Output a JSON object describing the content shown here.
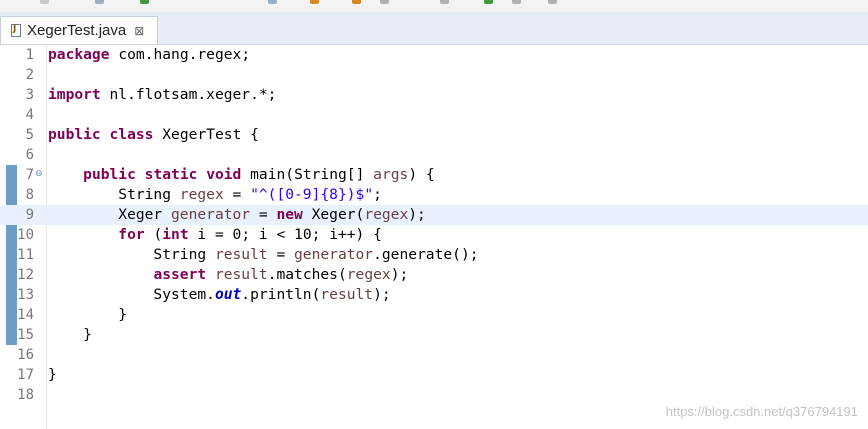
{
  "editor_tab": {
    "title": "XegerTest.java",
    "close_glyph": "⊠",
    "file_icon": "java-file-icon"
  },
  "code_lines": [
    {
      "n": "1",
      "tokens": [
        [
          "kw",
          "package"
        ],
        [
          "",
          "com.hang.regex;"
        ]
      ]
    },
    {
      "n": "2",
      "tokens": []
    },
    {
      "n": "3",
      "tokens": [
        [
          "kw",
          "import"
        ],
        [
          "",
          "nl.flotsam.xeger.*;"
        ]
      ]
    },
    {
      "n": "4",
      "tokens": []
    },
    {
      "n": "5",
      "tokens": [
        [
          "kw",
          "public"
        ],
        [
          "kw",
          "class"
        ],
        [
          "",
          "XegerTest {"
        ]
      ]
    },
    {
      "n": "6",
      "tokens": []
    },
    {
      "n": "7",
      "fold": "⊖",
      "tokens": [
        [
          "",
          "    "
        ],
        [
          "kw",
          "public"
        ],
        [
          "kw",
          "static"
        ],
        [
          "kw",
          "void"
        ],
        [
          "",
          "main(String[] "
        ],
        [
          "var",
          "args"
        ],
        [
          "",
          ") {"
        ]
      ]
    },
    {
      "n": "8",
      "tokens": [
        [
          "",
          "        String "
        ],
        [
          "var",
          "regex"
        ],
        [
          "",
          " = "
        ],
        [
          "str",
          "\"^([0-9]{8})$\""
        ],
        [
          "",
          ";"
        ]
      ]
    },
    {
      "n": "9",
      "current": true,
      "tokens": [
        [
          "",
          "        Xeger "
        ],
        [
          "var",
          "generator"
        ],
        [
          "",
          " = "
        ],
        [
          "kw",
          "new"
        ],
        [
          "",
          "Xeger("
        ],
        [
          "var",
          "regex"
        ],
        [
          "",
          ");"
        ]
      ]
    },
    {
      "n": "10",
      "tokens": [
        [
          "",
          "        "
        ],
        [
          "kw",
          "for"
        ],
        [
          "",
          "("
        ],
        [
          "kw",
          "int"
        ],
        [
          "",
          "i = 0; i < 10; i++) {"
        ]
      ]
    },
    {
      "n": "11",
      "tokens": [
        [
          "",
          "            String "
        ],
        [
          "var",
          "result"
        ],
        [
          "",
          " = "
        ],
        [
          "var",
          "generator"
        ],
        [
          "",
          ".generate();"
        ]
      ]
    },
    {
      "n": "12",
      "tokens": [
        [
          "",
          "            "
        ],
        [
          "kw",
          "assert"
        ],
        [
          "var",
          "result"
        ],
        [
          "",
          ".matches("
        ],
        [
          "var",
          "regex"
        ],
        [
          "",
          ");"
        ]
      ]
    },
    {
      "n": "13",
      "tokens": [
        [
          "",
          "            System."
        ],
        [
          "static",
          "out"
        ],
        [
          "",
          ".println("
        ],
        [
          "var",
          "result"
        ],
        [
          "",
          ");"
        ]
      ]
    },
    {
      "n": "14",
      "tokens": [
        [
          "",
          "        }"
        ]
      ]
    },
    {
      "n": "15",
      "tokens": [
        [
          "",
          "    }"
        ]
      ]
    },
    {
      "n": "16",
      "tokens": []
    },
    {
      "n": "17",
      "tokens": [
        [
          "",
          "}"
        ]
      ]
    },
    {
      "n": "18",
      "tokens": []
    }
  ],
  "watermark": "https://blog.csdn.net/q376794191",
  "colors": {
    "keyword": "#7f0055",
    "string": "#2a00ff",
    "local_variable": "#6a3e3e",
    "static_field": "#0000c0",
    "current_line": "#e8f2fe",
    "change_bar": "#6d9cc7"
  }
}
